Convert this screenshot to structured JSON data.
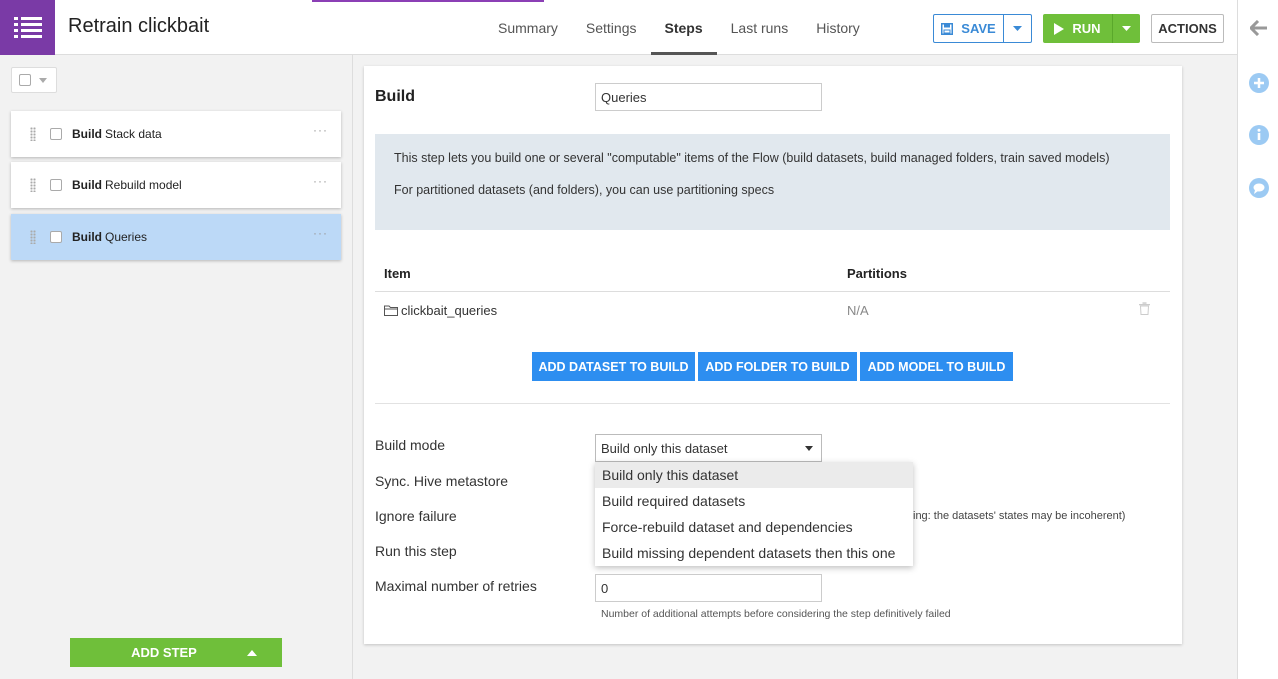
{
  "header": {
    "title": "Retrain clickbait",
    "tabs": [
      {
        "label": "Summary"
      },
      {
        "label": "Settings"
      },
      {
        "label": "Steps"
      },
      {
        "label": "Last runs"
      },
      {
        "label": "History"
      }
    ],
    "save_label": "SAVE",
    "run_label": "RUN",
    "actions_label": "ACTIONS"
  },
  "colors": {
    "accent_purple": "#7a3aa6",
    "run_green": "#6fbf3a",
    "primary_blue": "#2d8ef0",
    "selected_step": "#bcd9f7"
  },
  "steps": [
    {
      "kind": "Build",
      "name": "Stack data",
      "selected": false
    },
    {
      "kind": "Build",
      "name": "Rebuild model",
      "selected": false
    },
    {
      "kind": "Build",
      "name": "Queries",
      "selected": true
    }
  ],
  "add_step_label": "ADD STEP",
  "detail": {
    "title": "Build",
    "step_name_value": "Queries",
    "info_line1": "This step lets you build one or several \"computable\" items of the Flow (build datasets, build managed folders, train saved models)",
    "info_line2": "For partitioned datasets (and folders), you can use partitioning specs",
    "items_header": {
      "item": "Item",
      "partitions": "Partitions"
    },
    "items": [
      {
        "name": "clickbait_queries",
        "partitions": "N/A"
      }
    ],
    "add_dataset_label": "ADD DATASET TO BUILD",
    "add_folder_label": "ADD FOLDER TO BUILD",
    "add_model_label": "ADD MODEL TO BUILD",
    "build_mode_label": "Build mode",
    "build_mode_value": "Build only this dataset",
    "build_mode_options": [
      "Build only this dataset",
      "Build required datasets",
      "Force-rebuild dataset and dependencies",
      "Build missing dependent datasets then this one"
    ],
    "sync_hive_label": "Sync. Hive metastore",
    "ignore_failure_label": "Ignore failure",
    "ignore_failure_note": "ing: the datasets' states may be incoherent)",
    "run_step_label": "Run this step",
    "retries_label": "Maximal number of retries",
    "retries_value": "0",
    "retries_help": "Number of additional attempts before considering the step definitively failed"
  }
}
